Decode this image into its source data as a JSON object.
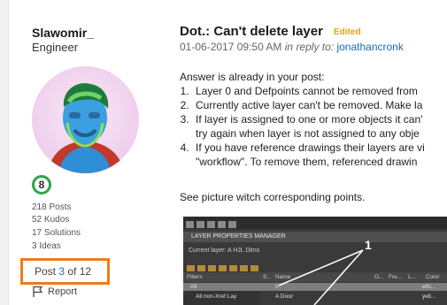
{
  "author": {
    "name": "Slawomir_",
    "role": "Engineer",
    "rank": "8",
    "stats": [
      "218 Posts",
      "52 Kudos",
      "17 Solutions",
      "3 Ideas"
    ],
    "post_label": "Post ",
    "post_index": "3",
    "post_of": " of 12",
    "report": "Report"
  },
  "post": {
    "title": "Dot.: Can't delete layer",
    "edited_badge": "Edited",
    "date": "01-06-2017 09:50 AM",
    "reply_prefix": "in reply to:",
    "reply_user": "jonathancronk",
    "intro": "Answer is already in your post:",
    "points": [
      "Layer 0 and Defpoints cannot be removed from",
      "Currently active layer can't be removed. Make la",
      "If layer is assigned to one or more objects it can'",
      "try again when layer is not assigned to any obje",
      "If you have reference drawings their layers are vi",
      "\"workflow\". To remove them, referenced drawin"
    ],
    "caption": "See picture witch corresponding points."
  },
  "embedded": {
    "panel_title": "LAYER PROPERTIES MANAGER",
    "current_layer": "Current layer: A HJL Dims",
    "filters_label": "Filters",
    "columns": [
      "S..",
      "Name",
      "O...",
      "Fre...",
      "L...",
      "Color"
    ],
    "rows": [
      {
        "filter": "All",
        "name": "0",
        "color": "whi..."
      },
      {
        "filter": "All non-Xref Lay",
        "name": "A Door",
        "color": "yell..."
      }
    ],
    "callout": "1"
  },
  "colors": {
    "link": "#1c6bb5",
    "edited": "#e3a40f",
    "highlight_box": "#f07a22",
    "rank_ring": "#2fa34a"
  }
}
